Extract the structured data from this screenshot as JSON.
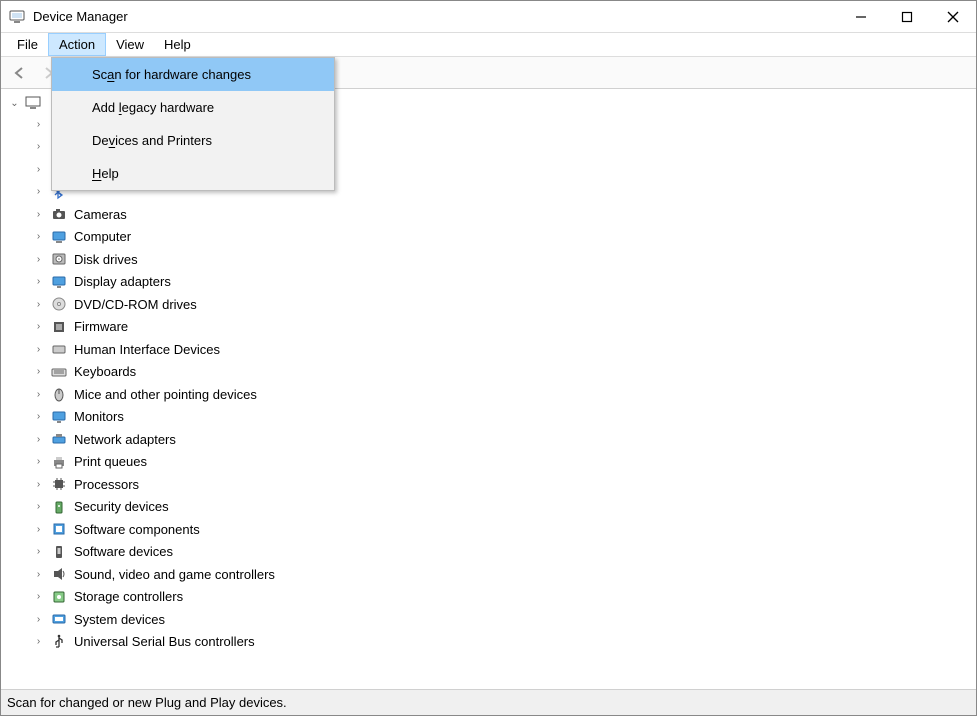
{
  "window": {
    "title": "Device Manager"
  },
  "menubar": {
    "items": [
      {
        "label": "File"
      },
      {
        "label": "Action"
      },
      {
        "label": "View"
      },
      {
        "label": "Help"
      }
    ],
    "open_index": 1
  },
  "action_menu": {
    "items": [
      {
        "label": "Scan for hardware changes",
        "highlight": true
      },
      {
        "label": "Add legacy hardware"
      },
      {
        "label": "Devices and Printers"
      },
      {
        "label": "Help"
      }
    ]
  },
  "tree": {
    "root_label": "",
    "categories": [
      {
        "label": "",
        "icon": "audio"
      },
      {
        "label": "",
        "icon": "battery"
      },
      {
        "label": "",
        "icon": "biometric"
      },
      {
        "label": "",
        "icon": "bluetooth"
      },
      {
        "label": "Cameras",
        "icon": "camera"
      },
      {
        "label": "Computer",
        "icon": "computer"
      },
      {
        "label": "Disk drives",
        "icon": "disk"
      },
      {
        "label": "Display adapters",
        "icon": "display"
      },
      {
        "label": "DVD/CD-ROM drives",
        "icon": "dvd"
      },
      {
        "label": "Firmware",
        "icon": "firmware"
      },
      {
        "label": "Human Interface Devices",
        "icon": "hid"
      },
      {
        "label": "Keyboards",
        "icon": "keyboard"
      },
      {
        "label": "Mice and other pointing devices",
        "icon": "mouse"
      },
      {
        "label": "Monitors",
        "icon": "monitor"
      },
      {
        "label": "Network adapters",
        "icon": "network"
      },
      {
        "label": "Print queues",
        "icon": "printer"
      },
      {
        "label": "Processors",
        "icon": "processor"
      },
      {
        "label": "Security devices",
        "icon": "security"
      },
      {
        "label": "Software components",
        "icon": "swcomp"
      },
      {
        "label": "Software devices",
        "icon": "swdev"
      },
      {
        "label": "Sound, video and game controllers",
        "icon": "sound"
      },
      {
        "label": "Storage controllers",
        "icon": "storage"
      },
      {
        "label": "System devices",
        "icon": "system"
      },
      {
        "label": "Universal Serial Bus controllers",
        "icon": "usb"
      }
    ]
  },
  "statusbar": {
    "text": "Scan for changed or new Plug and Play devices."
  }
}
